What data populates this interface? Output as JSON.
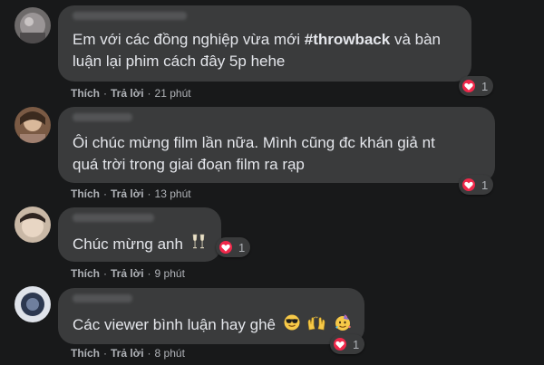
{
  "comments": [
    {
      "text_before": "Em với các đồng nghiệp vừa mới ",
      "hashtag": "#throwback",
      "text_after": " và bàn",
      "line2": "luận lại phim cách đây 5p hehe",
      "reaction_count": "1",
      "like_label": "Thích",
      "separator": "·",
      "reply_label": "Trả lời",
      "time": "21 phút"
    },
    {
      "line1": "Ôi chúc mừng film lần nữa. Mình cũng đc khán giả nt",
      "line2": "quá trời trong giai đoạn film ra rạp",
      "reaction_count": "1",
      "like_label": "Thích",
      "separator": "·",
      "reply_label": "Trả lời",
      "time": "13 phút"
    },
    {
      "line1": "Chúc mừng anh",
      "emoji": "clinking-glasses-icon",
      "reaction_count": "1",
      "like_label": "Thích",
      "separator": "·",
      "reply_label": "Trả lời",
      "time": "9 phút"
    },
    {
      "line1": "Các viewer bình luận hay ghê",
      "emojis": [
        "sunglasses-face-icon",
        "raising-hands-icon",
        "partying-face-icon"
      ],
      "reaction_count": "1",
      "like_label": "Thích",
      "separator": "·",
      "reply_label": "Trả lời",
      "time": "8 phút"
    }
  ],
  "colors": {
    "background": "#18191a",
    "bubble": "#3a3b3c",
    "text": "#e4e6eb",
    "secondary_text": "#b0b3b8",
    "love": "#f0284a"
  }
}
